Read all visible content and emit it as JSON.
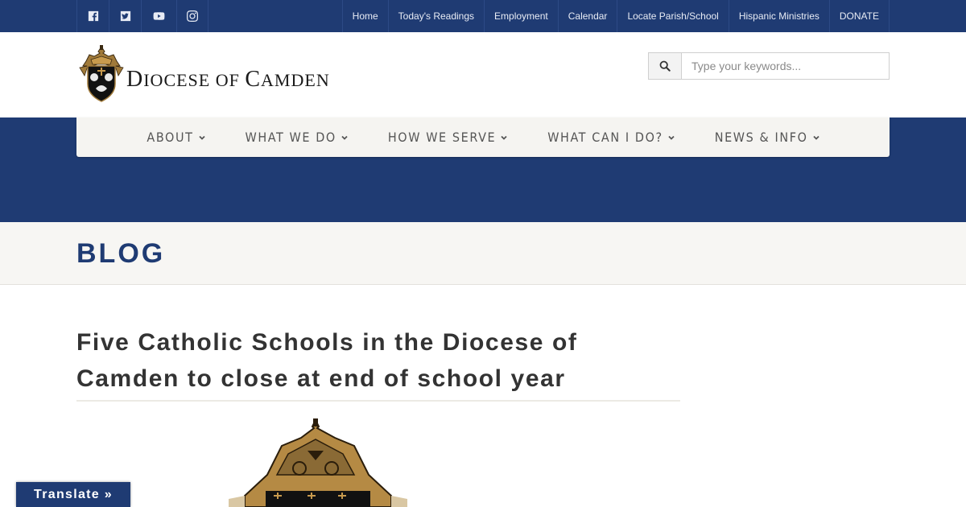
{
  "social": [
    {
      "name": "facebook",
      "icon": "facebook-icon"
    },
    {
      "name": "twitter",
      "icon": "twitter-icon"
    },
    {
      "name": "youtube",
      "icon": "youtube-icon"
    },
    {
      "name": "instagram",
      "icon": "instagram-icon"
    }
  ],
  "topnav": [
    "Home",
    "Today's Readings",
    "Employment",
    "Calendar",
    "Locate Parish/School",
    "Hispanic Ministries",
    "DONATE"
  ],
  "logo": {
    "text_d": "D",
    "text_iocese": "IOCESE OF ",
    "text_c": "C",
    "text_amden": "AMDEN",
    "icon": "diocese-crest-icon"
  },
  "search": {
    "placeholder": "Type your keywords...",
    "value": "",
    "icon": "search-icon"
  },
  "mainnav": [
    {
      "label": "ABOUT",
      "icon": "chevron-down-icon"
    },
    {
      "label": "WHAT WE DO",
      "icon": "chevron-down-icon"
    },
    {
      "label": "HOW WE SERVE",
      "icon": "chevron-down-icon"
    },
    {
      "label": "WHAT CAN I DO?",
      "icon": "chevron-down-icon"
    },
    {
      "label": "NEWS & INFO",
      "icon": "chevron-down-icon"
    }
  ],
  "page_title": "BLOG",
  "article": {
    "title": "Five Catholic Schools in the Diocese of Camden to close at end of school year"
  },
  "translate": {
    "label": "Translate »"
  },
  "colors": {
    "brand_blue": "#1f3b73",
    "nav_bg": "#f5f4f1",
    "title_bg": "#f7f6f3",
    "crest_gold": "#a07a3a"
  }
}
